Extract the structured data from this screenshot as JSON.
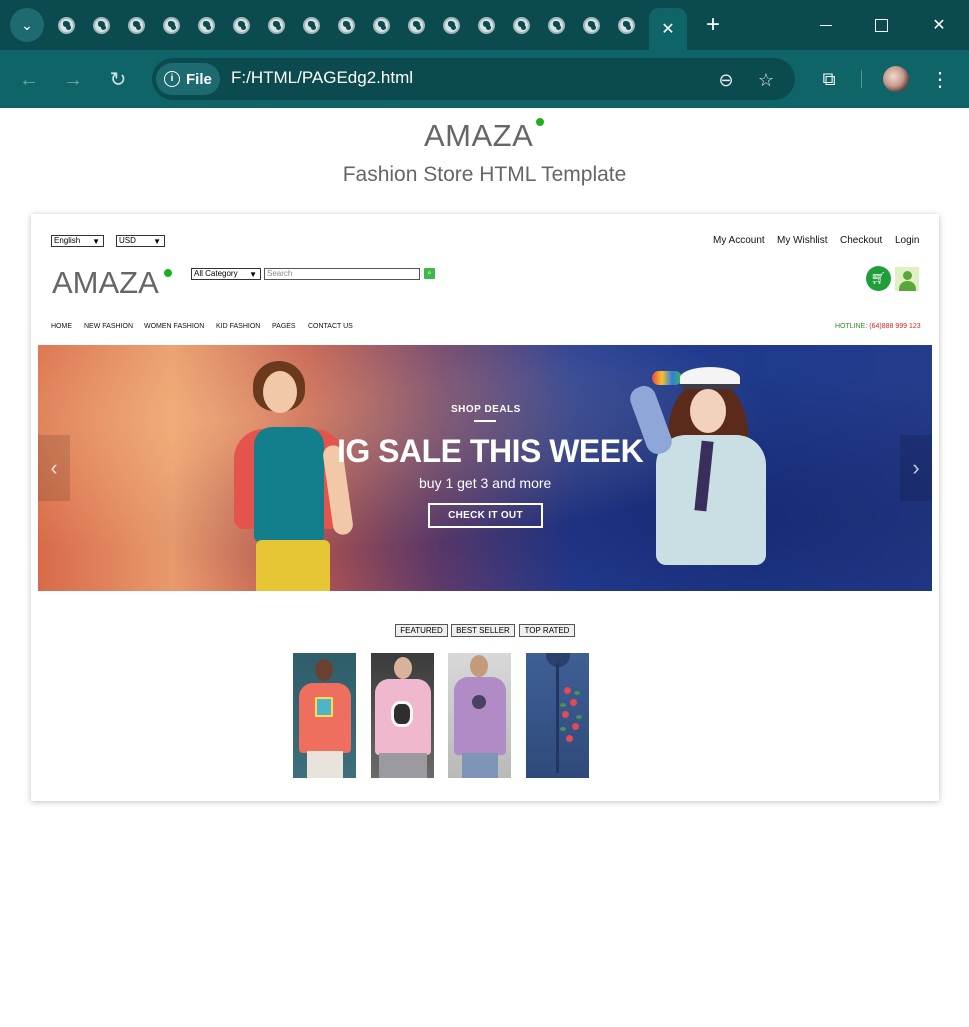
{
  "browser": {
    "active_tab_close": "✕",
    "new_tab": "+",
    "chip_label": "File",
    "url": "F:/HTML/PAGEdg2.html",
    "window_close": "✕"
  },
  "page": {
    "logo": "AMAZA",
    "subtitle": "Fashion Store HTML Template"
  },
  "store": {
    "language": "English",
    "currency": "USD",
    "top_links": [
      "My Account",
      "My Wishlist",
      "Checkout",
      "Login"
    ],
    "logo": "AMAZA",
    "category_select": "All Category",
    "search_placeholder": "Search",
    "menu": [
      "HOME",
      "NEW FASHION",
      "WOMEN FASHION",
      "KID FASHION",
      "PAGES",
      "CONTACT US"
    ],
    "hotline_label": "HOTLINE:",
    "hotline_number": "(64)888 999 123"
  },
  "banner": {
    "eyebrow": "SHOP DEALS",
    "headline": "IG SALE THIS WEEK",
    "subline": "buy 1 get 3 and more",
    "cta": "CHECK IT OUT",
    "prev": "‹",
    "next": "›"
  },
  "product_tabs": [
    "FEATURED",
    "BEST SELLER",
    "TOP RATED"
  ],
  "colors": {
    "chrome_dark": "#0b4a4e",
    "chrome_toolbar": "#0f6468",
    "brand_dot": "#1db01d",
    "hotline_label": "#2d8a2d",
    "hotline_number": "#d9261c",
    "cart_green": "#1f9e3a"
  }
}
